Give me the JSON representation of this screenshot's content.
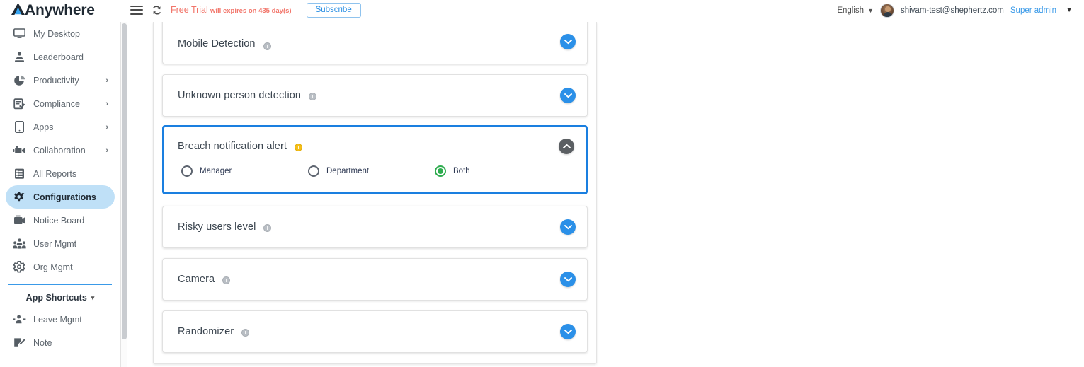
{
  "brand": {
    "name": "Anywhere",
    "logo_icon": "mountain-a-logo"
  },
  "topbar": {
    "menu_icon": "hamburger-menu-icon",
    "refresh_icon": "refresh-sync-icon",
    "trial_label": "Free Trial",
    "trial_sub_label": "will expires on 435 day(s)",
    "subscribe_label": "Subscribe",
    "language": "English",
    "language_caret_icon": "chevron-down-icon",
    "user_email": "shivam-test@shephertz.com",
    "user_role": "Super admin",
    "user_menu_caret_icon": "chevron-down-icon",
    "avatar_icon": "user-avatar"
  },
  "sidebar": {
    "items": [
      {
        "label": "My Desktop",
        "icon": "monitor-icon",
        "has_arrow": false,
        "active": false
      },
      {
        "label": "Leaderboard",
        "icon": "trophy-icon",
        "has_arrow": false,
        "active": false
      },
      {
        "label": "Productivity",
        "icon": "pie-chart-icon",
        "has_arrow": true,
        "active": false
      },
      {
        "label": "Compliance",
        "icon": "clipboard-check-icon",
        "has_arrow": true,
        "active": false
      },
      {
        "label": "Apps",
        "icon": "tablet-icon",
        "has_arrow": true,
        "active": false
      },
      {
        "label": "Collaboration",
        "icon": "video-camera-icon",
        "has_arrow": true,
        "active": false
      },
      {
        "label": "All Reports",
        "icon": "report-list-icon",
        "has_arrow": false,
        "active": false
      },
      {
        "label": "Configurations",
        "icon": "gear-settings-icon",
        "has_arrow": false,
        "active": true
      },
      {
        "label": "Notice Board",
        "icon": "notice-board-icon",
        "has_arrow": false,
        "active": false
      },
      {
        "label": "User Mgmt",
        "icon": "users-group-icon",
        "has_arrow": false,
        "active": false
      },
      {
        "label": "Org Mgmt",
        "icon": "org-gear-icon",
        "has_arrow": false,
        "active": false
      }
    ],
    "section": {
      "label": "App Shortcuts",
      "caret_icon": "chevron-down-icon"
    },
    "shortcuts": [
      {
        "label": "Leave Mgmt",
        "icon": "user-leave-icon"
      },
      {
        "label": "Note",
        "icon": "note-edit-icon"
      }
    ],
    "scrollbar": "vertical-scrollbar"
  },
  "main": {
    "cards": [
      {
        "title": "Mobile Detection",
        "info_state": "neutral",
        "expanded": false,
        "toggle_icon": "chevron-down-icon"
      },
      {
        "title": "Unknown person detection",
        "info_state": "neutral",
        "expanded": false,
        "toggle_icon": "chevron-down-icon"
      },
      {
        "title": "Breach notification alert",
        "info_state": "warning",
        "expanded": true,
        "toggle_icon": "chevron-up-icon",
        "options": [
          {
            "label": "Manager",
            "selected": false
          },
          {
            "label": "Department",
            "selected": false
          },
          {
            "label": "Both",
            "selected": true
          }
        ]
      },
      {
        "title": "Risky users level",
        "info_state": "neutral",
        "expanded": false,
        "toggle_icon": "chevron-down-icon"
      },
      {
        "title": "Camera",
        "info_state": "neutral",
        "expanded": false,
        "toggle_icon": "chevron-down-icon"
      },
      {
        "title": "Randomizer",
        "info_state": "neutral",
        "expanded": false,
        "toggle_icon": "chevron-down-icon"
      }
    ]
  },
  "colors": {
    "accent_blue": "#2b90e8",
    "active_nav_bg": "#bfe0f7",
    "trial_red": "#f2756a",
    "selected_radio_green": "#2eac4f",
    "warning_yellow": "#f5bf19",
    "focus_border": "#1a7fe0"
  }
}
